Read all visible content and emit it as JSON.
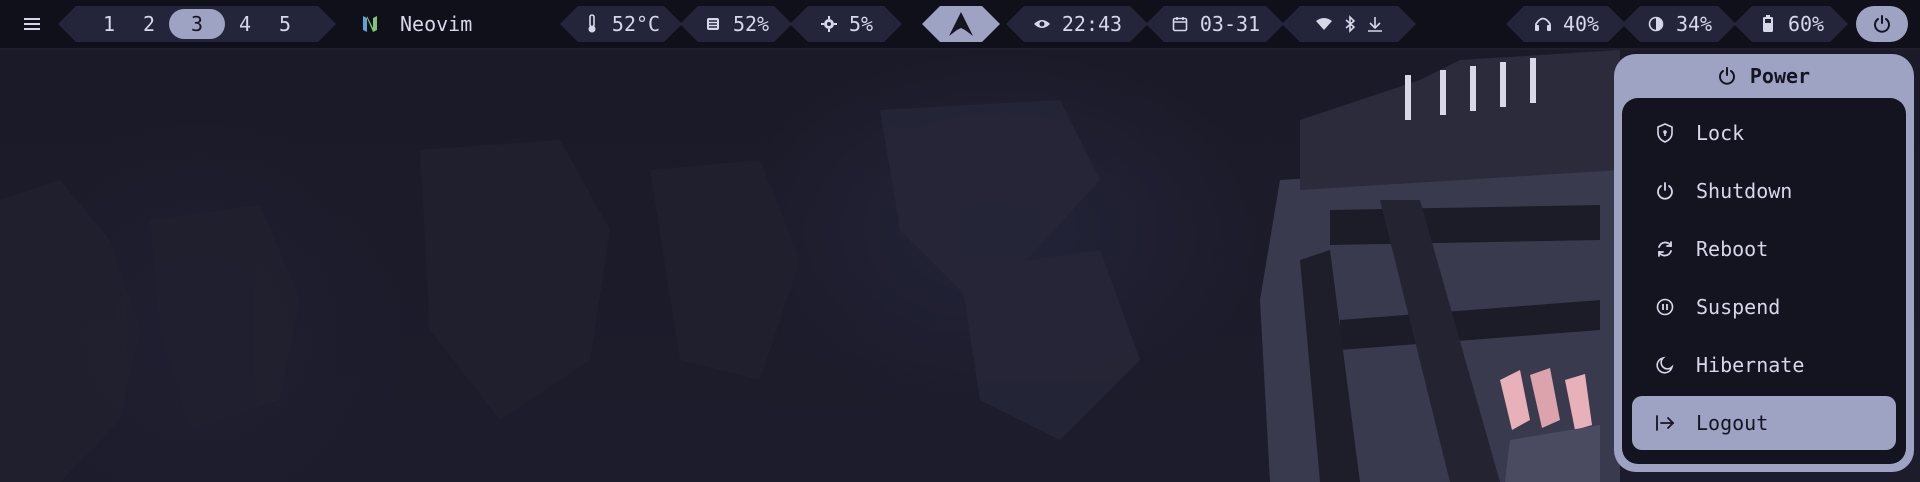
{
  "topbar": {
    "menu_icon": "hamburger-icon",
    "workspaces": [
      {
        "label": "1",
        "active": false
      },
      {
        "label": "2",
        "active": false
      },
      {
        "label": "3",
        "active": true
      },
      {
        "label": "4",
        "active": false
      },
      {
        "label": "5",
        "active": false
      }
    ],
    "app": {
      "icon": "neovim-icon",
      "name": "Neovim"
    },
    "temperature": {
      "icon": "thermometer-icon",
      "value": "52°C"
    },
    "memory": {
      "icon": "memory-icon",
      "value": "52%"
    },
    "cpu": {
      "icon": "cpu-icon",
      "value": "5%"
    },
    "logo": {
      "icon": "arch-logo-icon"
    },
    "clock": {
      "icon": "eye-icon",
      "value": "22:43"
    },
    "date": {
      "icon": "calendar-icon",
      "value": "03-31"
    },
    "tray": [
      "wifi-icon",
      "bluetooth-icon",
      "download-icon"
    ],
    "volume": {
      "icon": "headphones-icon",
      "value": "40%"
    },
    "brightness": {
      "icon": "contrast-icon",
      "value": "34%"
    },
    "battery": {
      "icon": "battery-icon",
      "value": "60%"
    },
    "power": {
      "icon": "power-icon"
    }
  },
  "power_menu": {
    "title": "Power",
    "title_icon": "power-icon",
    "items": [
      {
        "label": "Lock",
        "icon": "shield-lock-icon",
        "selected": false
      },
      {
        "label": "Shutdown",
        "icon": "power-icon",
        "selected": false
      },
      {
        "label": "Reboot",
        "icon": "refresh-icon",
        "selected": false
      },
      {
        "label": "Suspend",
        "icon": "pause-circle-icon",
        "selected": false
      },
      {
        "label": "Hibernate",
        "icon": "moon-icon",
        "selected": false
      },
      {
        "label": "Logout",
        "icon": "logout-icon",
        "selected": true
      }
    ]
  },
  "colors": {
    "bar_bg": "#10101a",
    "segment_bg": "#24243a",
    "accent": "#9ea3c4",
    "menu_bg": "#141420",
    "neovim_green": "#7ec47a"
  }
}
